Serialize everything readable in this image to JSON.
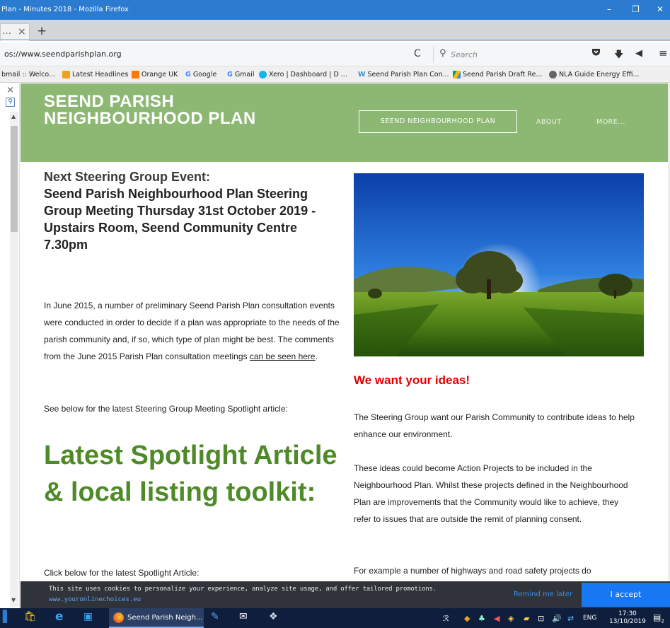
{
  "window": {
    "title": "Plan - Minutes 2018 - Mozilla Firefox",
    "minimize": "–",
    "restore": "❐",
    "close": "✕"
  },
  "tabs": {
    "fragment_label": "…",
    "close_glyph": "×",
    "new_tab": "+"
  },
  "navbar": {
    "url": "os://www.seendparishplan.org",
    "reload_glyph": "C",
    "search_placeholder": "Search"
  },
  "bookmarks": [
    {
      "label": "bmail :: Welco...",
      "color": ""
    },
    {
      "label": "Latest Headlines",
      "color": "#f0a020"
    },
    {
      "label": "Orange UK",
      "color": "#ff7900"
    },
    {
      "label": "Google",
      "color": "#4285f4"
    },
    {
      "label": "Gmail",
      "color": "#4285f4"
    },
    {
      "label": "Xero | Dashboard | D ...",
      "color": "#13b5ea"
    },
    {
      "label": "Seend Parish Plan Con...",
      "color": "#3c8de0"
    },
    {
      "label": "Seend Parish Draft Re...",
      "color": "#fbbc04"
    },
    {
      "label": "NLA Guide Energy Effi...",
      "color": "#666666"
    }
  ],
  "site": {
    "title": "SEEND PARISH NEIGHBOURHOOD PLAN",
    "nav": {
      "button": "SEEND NEIGHBOURHOOD PLAN",
      "about": "ABOUT",
      "more": "MORE..."
    },
    "event_heading_line1": "Next Steering Group Event:",
    "event_heading_rest": "Seend Parish Neighbourhood Plan Steering Group Meeting Thursday 31st October 2019 - Upstairs Room, Seend Community Centre 7.30pm",
    "intro_text": "In June 2015, a number of preliminary Seend Parish Plan consultation events were conducted in order to decide if a plan was appropriate to the needs of the parish community and, if so, which type of plan might be best.  The comments from the June 2015 Parish Plan consultation meetings ",
    "intro_link": "can be seen here",
    "intro_end": ".",
    "see_below": "See below for the latest Steering Group Meeting Spotlight article:",
    "spotlight_heading": "Latest Spotlight Article & local listing toolkit:",
    "click_below": "Click below for the latest Spotlight Article:",
    "ideas_heading": "We want your ideas!",
    "ideas_p1": "The Steering Group want our Parish Community to contribute ideas to help enhance our environment.",
    "ideas_p2": "These ideas could become Action Projects to be included in the Neighbourhood Plan. Whilst these projects defined in the Neighbourhood Plan are improvements that the Community would like to achieve, they refer to issues that are outside the remit of planning consent.",
    "ideas_p3": "For example a number of highways and road safety projects do"
  },
  "cookie": {
    "text": "This site uses cookies to personalize your experience, analyze site usage, and offer tailored promotions.",
    "link": "www.youronlinechoices.eu",
    "remind": "Remind me later",
    "accept": "I accept"
  },
  "taskbar": {
    "firefox_label": "Seend Parish Neigh...",
    "lang": "ENG",
    "time": "17:30",
    "date": "13/10/2019",
    "notification_count": "2"
  },
  "colors": {
    "header_green": "#8cb873",
    "spotlight_green": "#4f8a28",
    "ideas_red": "#e00000",
    "accept_blue": "#1877f2"
  }
}
